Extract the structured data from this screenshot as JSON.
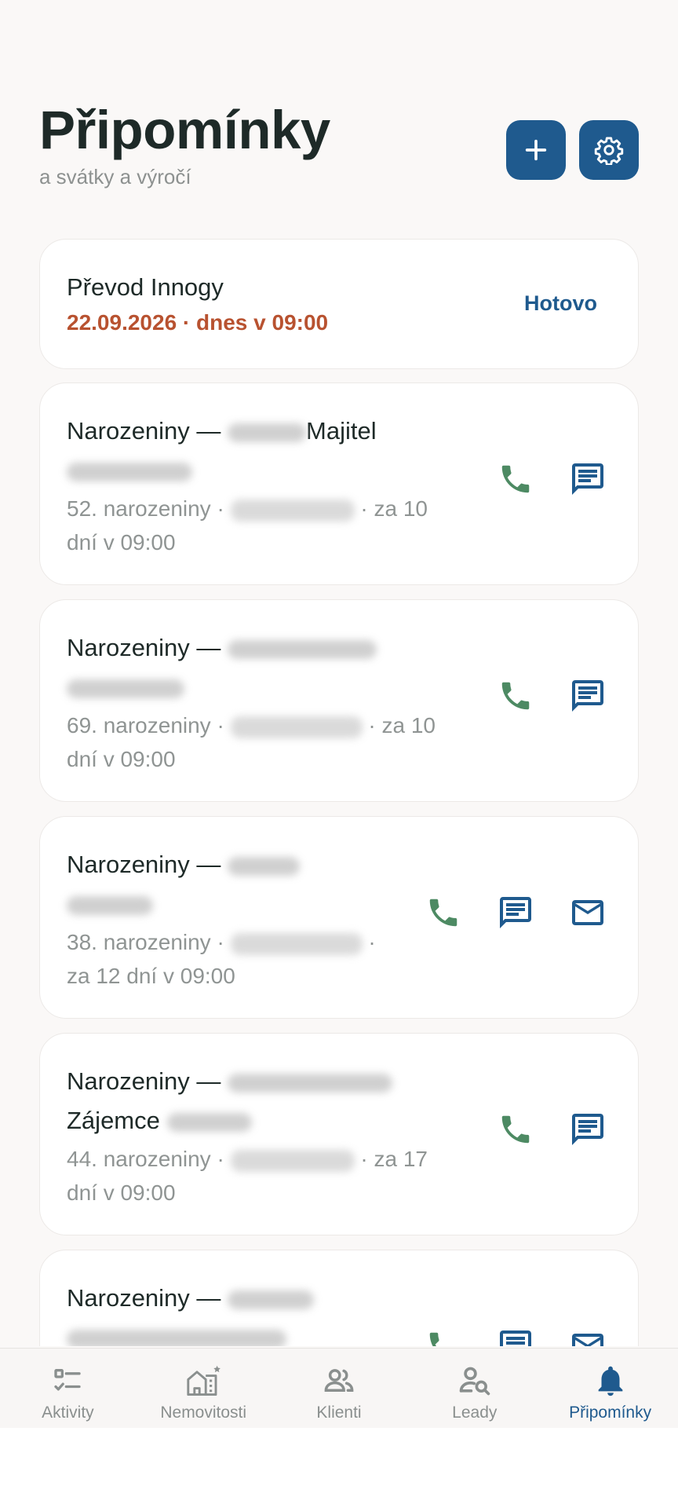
{
  "header": {
    "title": "Připomínky",
    "subtitle": "a svátky a výročí",
    "add_icon": "plus-icon",
    "settings_icon": "gear-icon"
  },
  "task": {
    "title": "Převod Innogy",
    "date": "22.09.2026 · dnes v 09:00",
    "done_label": "Hotovo"
  },
  "birthdays": [
    {
      "title_prefix": "Narozeniny —",
      "title_suffix": "Majitel",
      "detail_prefix": "52. narozeniny ·",
      "detail_suffix": "· za 10 dní v 09:00",
      "actions": [
        "phone-icon",
        "message-icon"
      ]
    },
    {
      "title_prefix": "Narozeniny —",
      "title_suffix": "",
      "detail_prefix": "69. narozeniny ·",
      "detail_suffix": "· za 10 dní v 09:00",
      "actions": [
        "phone-icon",
        "message-icon"
      ]
    },
    {
      "title_prefix": "Narozeniny —",
      "title_suffix": "",
      "detail_prefix": "38. narozeniny ·",
      "detail_suffix": "· za 12 dní v 09:00",
      "actions": [
        "phone-icon",
        "message-icon",
        "mail-icon"
      ]
    },
    {
      "title_prefix": "Narozeniny —",
      "title_suffix": "Zájemce",
      "detail_prefix": "44. narozeniny ·",
      "detail_suffix": "· za 17 dní v 09:00",
      "actions": [
        "phone-icon",
        "message-icon"
      ]
    },
    {
      "title_prefix": "Narozeniny —",
      "title_suffix": "",
      "actions": [
        "phone-icon",
        "message-icon",
        "mail-icon"
      ]
    }
  ],
  "tabs": [
    {
      "label": "Aktivity",
      "icon": "checklist-icon"
    },
    {
      "label": "Nemovitosti",
      "icon": "building-icon"
    },
    {
      "label": "Klienti",
      "icon": "people-icon"
    },
    {
      "label": "Leady",
      "icon": "person-search-icon"
    },
    {
      "label": "Připomínky",
      "icon": "bell-icon",
      "active": true
    }
  ],
  "colors": {
    "primary": "#1f5a8e",
    "phone": "#4d8a63",
    "overdue": "#b85230",
    "title": "#1e2a28",
    "muted": "#8f9493"
  }
}
